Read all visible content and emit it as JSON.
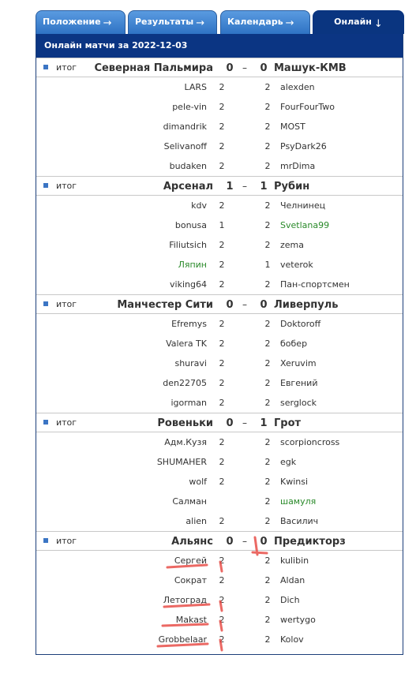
{
  "tabs": [
    {
      "label": "Положение",
      "arrow": "→"
    },
    {
      "label": "Результаты",
      "arrow": "→"
    },
    {
      "label": "Календарь",
      "arrow": "→"
    },
    {
      "label": "Онлайн",
      "arrow": "↓"
    }
  ],
  "header_title": "Онлайн матчи за 2022-12-03",
  "colors": {
    "accent": "#0b3583",
    "tab": "#3a82d4",
    "highlight_green": "#2a8a2a",
    "annotation_red": "#e8504a"
  },
  "matches": [
    {
      "status": "итог",
      "home": "Северная Пальмира",
      "home_score": "0",
      "dash": "–",
      "away_score": "0",
      "away": "Машук-КМВ",
      "rows": [
        {
          "p1": "LARS",
          "s1": "2",
          "s2": "2",
          "p2": "alexden"
        },
        {
          "p1": "pele-vin",
          "s1": "2",
          "s2": "2",
          "p2": "FourFourTwo"
        },
        {
          "p1": "dimandrik",
          "s1": "2",
          "s2": "2",
          "p2": "MOST"
        },
        {
          "p1": "Selivanoff",
          "s1": "2",
          "s2": "2",
          "p2": "PsyDark26"
        },
        {
          "p1": "budaken",
          "s1": "2",
          "s2": "2",
          "p2": "mrDima"
        }
      ]
    },
    {
      "status": "итог",
      "home": "Арсенал",
      "home_score": "1",
      "dash": "–",
      "away_score": "1",
      "away": "Рубин",
      "rows": [
        {
          "p1": "kdv",
          "s1": "2",
          "s2": "2",
          "p2": "Челнинец"
        },
        {
          "p1": "bonusa",
          "s1": "1",
          "s2": "2",
          "p2": "Svetlana99",
          "p2_green": true
        },
        {
          "p1": "Filiutsich",
          "s1": "2",
          "s2": "2",
          "p2": "zema"
        },
        {
          "p1": "Ляпин",
          "s1": "2",
          "s2": "1",
          "p2": "veterok",
          "p1_green": true
        },
        {
          "p1": "viking64",
          "s1": "2",
          "s2": "2",
          "p2": "Пан-спортсмен"
        }
      ]
    },
    {
      "status": "итог",
      "home": "Манчестер Сити",
      "home_score": "0",
      "dash": "–",
      "away_score": "0",
      "away": "Ливерпуль",
      "rows": [
        {
          "p1": "Efremys",
          "s1": "2",
          "s2": "2",
          "p2": "Doktoroff"
        },
        {
          "p1": "Valera TK",
          "s1": "2",
          "s2": "2",
          "p2": "бобер"
        },
        {
          "p1": "shuravi",
          "s1": "2",
          "s2": "2",
          "p2": "Xeruvim"
        },
        {
          "p1": "den22705",
          "s1": "2",
          "s2": "2",
          "p2": "Евгений"
        },
        {
          "p1": "igorman",
          "s1": "2",
          "s2": "2",
          "p2": "serglock"
        }
      ]
    },
    {
      "status": "итог",
      "home": "Ровеньки",
      "home_score": "0",
      "dash": "–",
      "away_score": "1",
      "away": "Грот",
      "rows": [
        {
          "p1": "Адм.Кузя",
          "s1": "2",
          "s2": "2",
          "p2": "scorpioncross"
        },
        {
          "p1": "SHUMAHER",
          "s1": "2",
          "s2": "2",
          "p2": "egk"
        },
        {
          "p1": "wolf",
          "s1": "2",
          "s2": "2",
          "p2": "Kwinsi"
        },
        {
          "p1": "Салман",
          "s1": "",
          "s2": "2",
          "p2": "шамуля",
          "p2_green": true
        },
        {
          "p1": "alien",
          "s1": "2",
          "s2": "2",
          "p2": "Василич"
        }
      ]
    },
    {
      "status": "итог",
      "home": "Альянс",
      "home_score": "0",
      "dash": "–",
      "away_score": "0",
      "away": "Предикторз",
      "rows": [
        {
          "p1": "Сергей",
          "s1": "2",
          "s2": "2",
          "p2": "kulibin"
        },
        {
          "p1": "Сократ",
          "s1": "2",
          "s2": "2",
          "p2": "Aldan"
        },
        {
          "p1": "Летоград",
          "s1": "2",
          "s2": "2",
          "p2": "Dich"
        },
        {
          "p1": "Makast",
          "s1": "2",
          "s2": "2",
          "p2": "wertygo"
        },
        {
          "p1": "Grobbelaar",
          "s1": "2",
          "s2": "2",
          "p2": "Kolov"
        }
      ]
    }
  ]
}
